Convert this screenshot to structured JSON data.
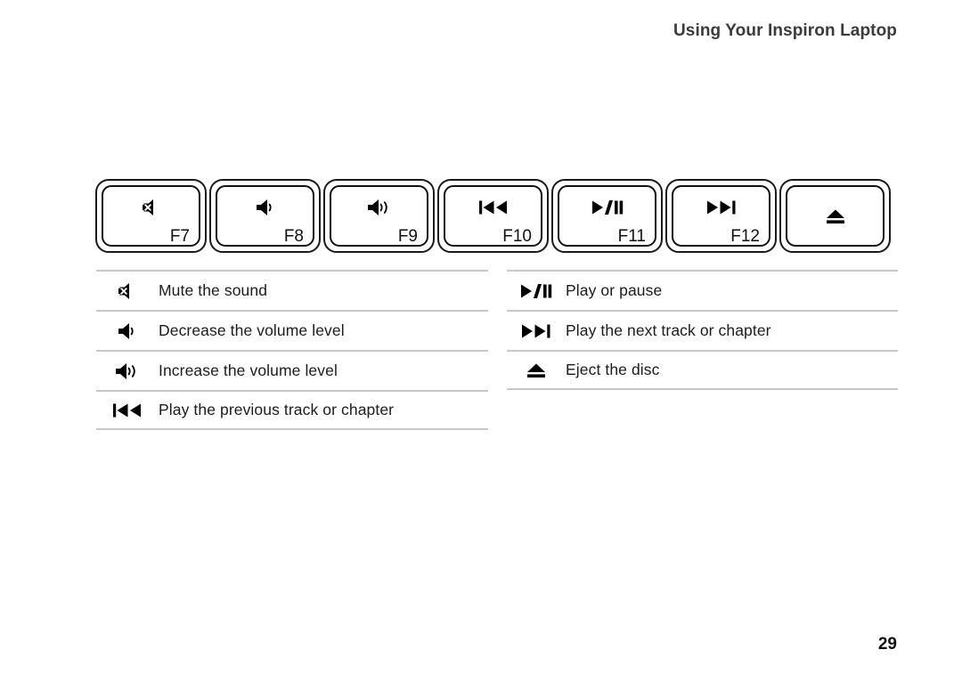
{
  "header": {
    "title": "Using Your Inspiron Laptop"
  },
  "keys": [
    {
      "icon": "mute-icon",
      "label": "F7"
    },
    {
      "icon": "volume-down-icon",
      "label": "F8"
    },
    {
      "icon": "volume-up-icon",
      "label": "F9"
    },
    {
      "icon": "previous-track-icon",
      "label": "F10"
    },
    {
      "icon": "play-pause-icon",
      "label": "F11"
    },
    {
      "icon": "next-track-icon",
      "label": "F12"
    },
    {
      "icon": "eject-icon",
      "label": ""
    }
  ],
  "legend_left": [
    {
      "icon": "mute-icon",
      "text": "Mute the sound"
    },
    {
      "icon": "volume-down-icon",
      "text": "Decrease the volume level"
    },
    {
      "icon": "volume-up-icon",
      "text": "Increase the volume level"
    },
    {
      "icon": "previous-track-icon",
      "text": "Play the previous track or chapter"
    }
  ],
  "legend_right": [
    {
      "icon": "play-pause-icon",
      "text": "Play or pause"
    },
    {
      "icon": "next-track-icon",
      "text": "Play the next track or chapter"
    },
    {
      "icon": "eject-icon",
      "text": "Eject the disc"
    }
  ],
  "footer": {
    "page_number": "29"
  },
  "colors": {
    "text": "#1c1c1c",
    "header_text": "#3b3b3b",
    "key_outline": "#111111",
    "rule": "#c8c8c8",
    "background": "#ffffff"
  }
}
